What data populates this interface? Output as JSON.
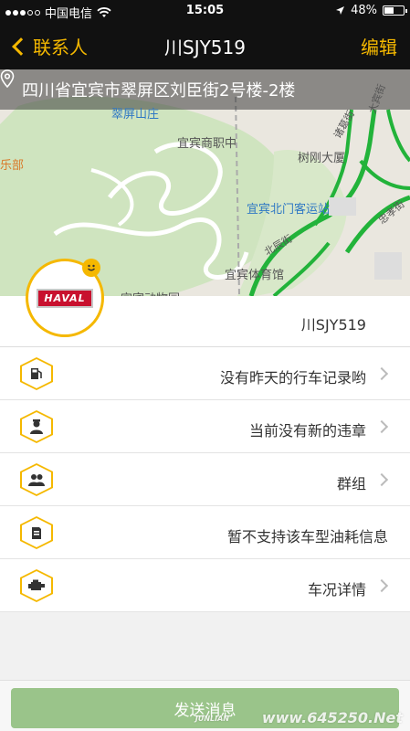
{
  "status_bar": {
    "carrier": "中国电信",
    "time": "15:05",
    "battery": "48%",
    "battery_level": 0.48
  },
  "nav": {
    "back_label": "联系人",
    "title": "川SJY519",
    "edit_label": "编辑"
  },
  "map": {
    "address": "四川省宜宾市翠屏区刘臣街2号楼-2楼",
    "labels": {
      "cuiping_villa": "翠屏山庄",
      "vocational_school": "宜宾商职中",
      "club": "乐部",
      "shugang_building": "树刚大厦",
      "bus_station": "宜宾北门客运站",
      "stadium": "宜宾体育馆",
      "museum": "宜宾动物园",
      "road1": "北辰街",
      "road2": "诸葛街",
      "road3": "忠孝街",
      "road4": "大宾街"
    }
  },
  "vehicle": {
    "brand_logo": "HAVAL",
    "plate": "川SJY519"
  },
  "list_items": [
    {
      "label": "没有昨天的行车记录哟",
      "icon": "fuel-pump-icon",
      "has_arrow": true
    },
    {
      "label": "当前没有新的违章",
      "icon": "police-officer-icon",
      "has_arrow": true
    },
    {
      "label": "群组",
      "icon": "group-people-icon",
      "has_arrow": true
    },
    {
      "label": "暂不支持该车型油耗信息",
      "icon": "fuel-can-icon",
      "has_arrow": false
    },
    {
      "label": "车况详情",
      "icon": "engine-icon",
      "has_arrow": true
    }
  ],
  "send_button": "发送消息",
  "watermark": {
    "brand": "JUNLIAN",
    "site": "www.645250.Net"
  },
  "colors": {
    "accent": "#f5b800",
    "send_button": "#9ac48a",
    "nav_bg": "#111111"
  }
}
